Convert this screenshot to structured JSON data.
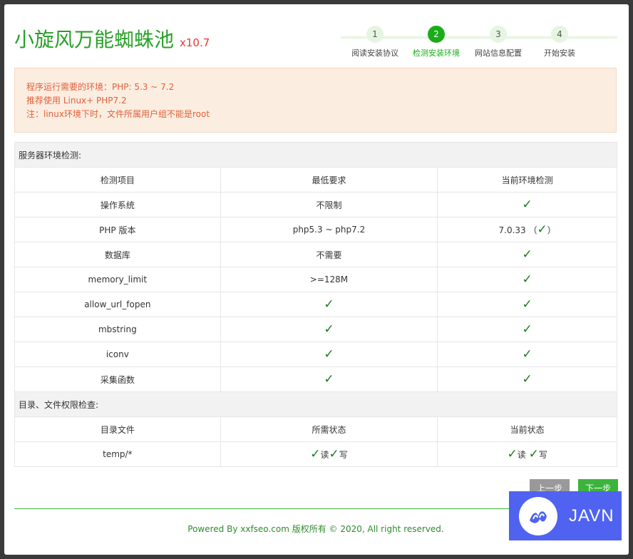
{
  "header": {
    "title": "小旋风万能蜘蛛池",
    "version": "x10.7"
  },
  "steps": [
    {
      "num": "1",
      "label": "阅读安装协议"
    },
    {
      "num": "2",
      "label": "检测安装环境"
    },
    {
      "num": "3",
      "label": "网站信息配置"
    },
    {
      "num": "4",
      "label": "开始安装"
    }
  ],
  "active_step": 2,
  "notice": {
    "line1": "程序运行需要的环境：PHP: 5.3 ~ 7.2",
    "line2": "推荐使用 Linux+ PHP7.2",
    "line3": "注：linux环境下时，文件所属用户组不能是root"
  },
  "server_check": {
    "section_title": "服务器环境检测:",
    "headers": [
      "检测项目",
      "最低要求",
      "当前环境检测"
    ],
    "rows": [
      {
        "item": "操作系统",
        "requirement": "不限制",
        "current": "✓"
      },
      {
        "item": "PHP 版本",
        "requirement": "php5.3 ~ php7.2",
        "current_version": "7.0.33",
        "current": "✓"
      },
      {
        "item": "数据库",
        "requirement": "不需要",
        "current": "✓"
      },
      {
        "item": "memory_limit",
        "requirement": ">=128M",
        "current": "✓"
      },
      {
        "item": "allow_url_fopen",
        "requirement": "✓",
        "current": "✓"
      },
      {
        "item": "mbstring",
        "requirement": "✓",
        "current": "✓"
      },
      {
        "item": "iconv",
        "requirement": "✓",
        "current": "✓"
      },
      {
        "item": "采集函数",
        "requirement": "✓",
        "current": "✓"
      }
    ]
  },
  "perm_check": {
    "section_title": "目录、文件权限检查:",
    "headers": [
      "目录文件",
      "所需状态",
      "当前状态"
    ],
    "rows": [
      {
        "path": "temp/*",
        "check": "✓",
        "read": "读",
        "write": "写"
      }
    ]
  },
  "buttons": {
    "prev": "上一步",
    "next": "下一步"
  },
  "footer": {
    "text": "Powered By xxfseo.com 版权所有 © 2020, All right reserved."
  },
  "watermark": {
    "text": "JAVN"
  },
  "colors": {
    "brand_green": "#28a028",
    "accent_red": "#e53935",
    "notice_bg": "#fcede1",
    "watermark_blue": "#4f63f0"
  }
}
